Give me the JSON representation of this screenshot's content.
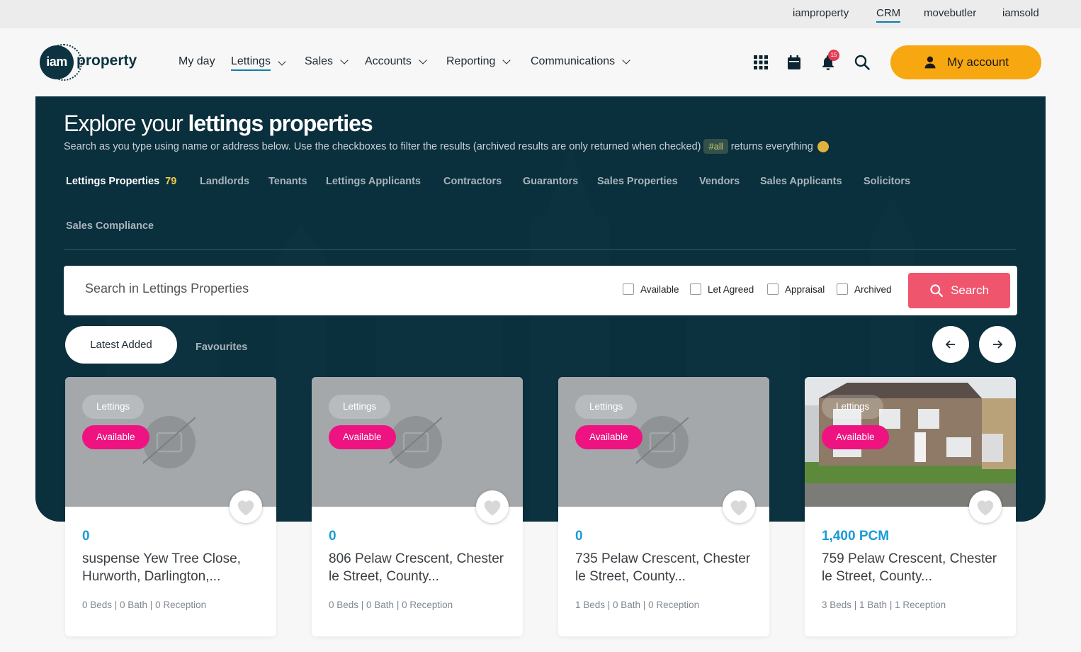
{
  "top_links": [
    "iamproperty",
    "CRM",
    "movebutler",
    "iamsold"
  ],
  "logo": {
    "mark": "iam",
    "word": "property"
  },
  "nav": [
    {
      "label": "My day",
      "dropdown": false
    },
    {
      "label": "Lettings",
      "dropdown": true,
      "active": true
    },
    {
      "label": "Sales",
      "dropdown": true
    },
    {
      "label": "Accounts",
      "dropdown": true
    },
    {
      "label": "Reporting",
      "dropdown": true
    },
    {
      "label": "Communications",
      "dropdown": true
    }
  ],
  "header_icons": [
    "apps-grid-icon",
    "calendar-icon",
    "bell-icon",
    "search-icon"
  ],
  "notifications_count": "15",
  "account_label": "My account",
  "hero": {
    "title_light": "Explore your ",
    "title_bold": "lettings properties",
    "subtitle_before": "Search as you type using name or address below. Use the checkboxes to filter the results (archived results are only returned when checked)",
    "subtitle_tag": "#all",
    "subtitle_after": "returns everything"
  },
  "tabs": [
    {
      "label": "Lettings Properties",
      "count": "79",
      "active": true
    },
    {
      "label": "Landlords"
    },
    {
      "label": "Tenants"
    },
    {
      "label": "Lettings Applicants"
    },
    {
      "label": "Contractors"
    },
    {
      "label": "Guarantors"
    },
    {
      "label": "Sales Properties"
    },
    {
      "label": "Vendors"
    },
    {
      "label": "Sales Applicants"
    },
    {
      "label": "Solicitors"
    },
    {
      "label": "Sales Compliance"
    }
  ],
  "search": {
    "placeholder": "Search in Lettings Properties",
    "filters": [
      "Available",
      "Let Agreed",
      "Appraisal",
      "Archived"
    ],
    "button": "Search"
  },
  "list_tabs": {
    "latest": "Latest Added",
    "favourites": "Favourites"
  },
  "colors": {
    "navy": "#0a2f3d",
    "accent": "#f7a70f",
    "search_btn": "#f0556e",
    "status": "#ee1380",
    "price": "#199bd8"
  },
  "cards": [
    {
      "type": "Lettings",
      "status": "Available",
      "price": "0",
      "address": "suspense Yew Tree Close, Hurworth, Darlington,...",
      "meta": "0 Beds | 0 Bath | 0 Reception",
      "has_photo": false
    },
    {
      "type": "Lettings",
      "status": "Available",
      "price": "0",
      "address": "806 Pelaw Crescent, Chester le Street, County...",
      "meta": "0 Beds | 0 Bath | 0 Reception",
      "has_photo": false
    },
    {
      "type": "Lettings",
      "status": "Available",
      "price": "0",
      "address": "735 Pelaw Crescent, Chester le Street, County...",
      "meta": "1 Beds | 0 Bath | 0 Reception",
      "has_photo": false
    },
    {
      "type": "Lettings",
      "status": "Available",
      "price": "1,400 PCM",
      "address": "759 Pelaw Crescent, Chester le Street, County...",
      "meta": "3 Beds | 1 Bath | 1 Reception",
      "has_photo": true
    }
  ]
}
